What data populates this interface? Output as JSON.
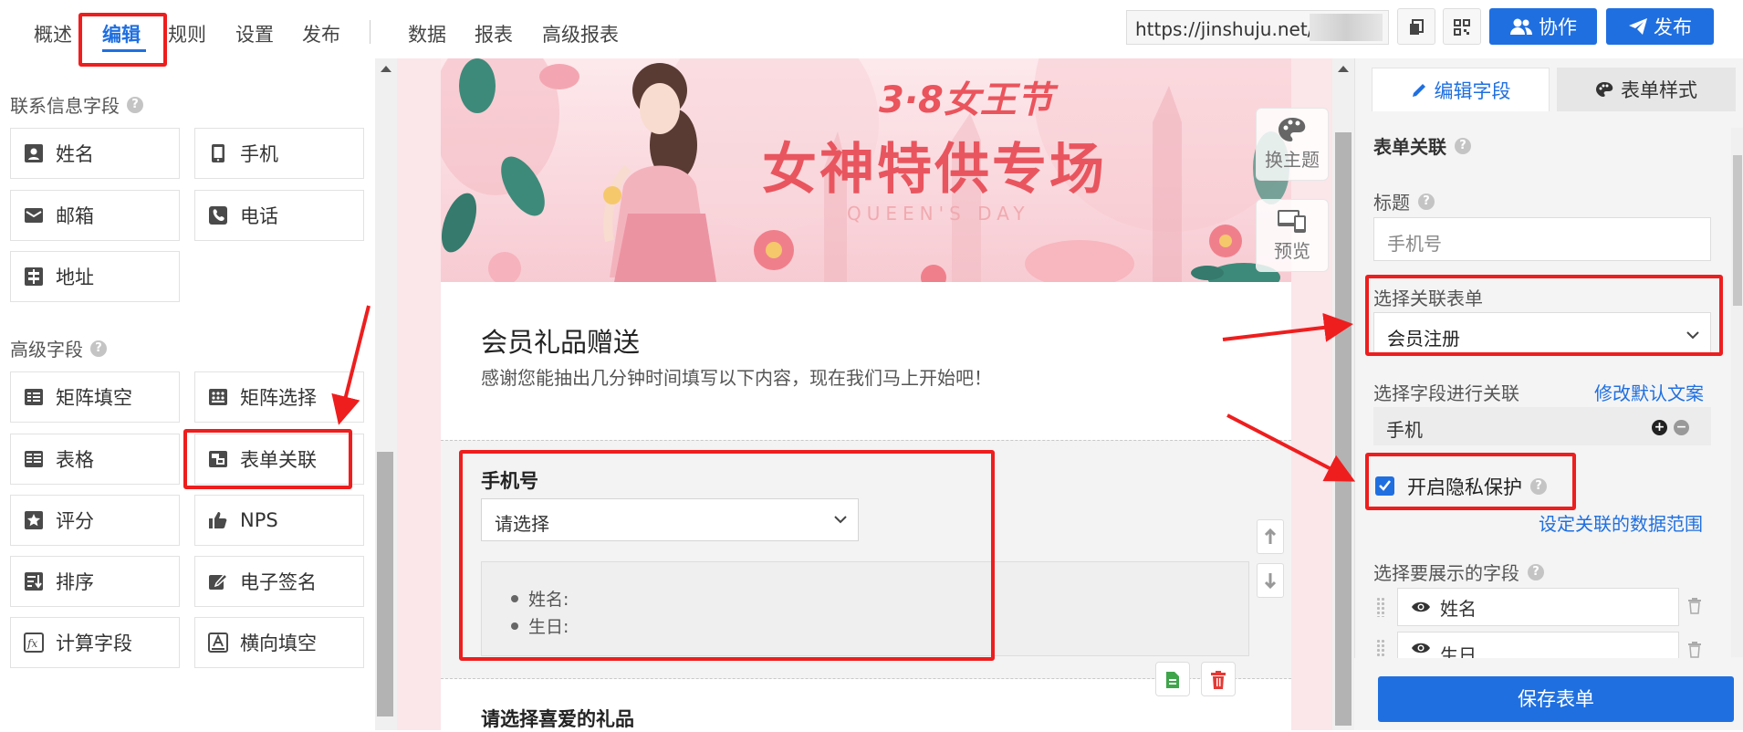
{
  "nav": {
    "tabs": [
      {
        "label": "概述"
      },
      {
        "label": "编辑"
      },
      {
        "label": "规则"
      },
      {
        "label": "设置"
      },
      {
        "label": "发布"
      },
      {
        "label": "数据"
      },
      {
        "label": "报表"
      },
      {
        "label": "高级报表"
      }
    ],
    "url": "https://jinshuju.net/f",
    "collab_label": "协作",
    "publish_label": "发布"
  },
  "left": {
    "contact_title": "联系信息字段",
    "contact_fields": [
      {
        "label": "姓名",
        "icon": "contact-card-icon"
      },
      {
        "label": "手机",
        "icon": "mobile-phone-icon"
      },
      {
        "label": "邮箱",
        "icon": "mail-icon"
      },
      {
        "label": "电话",
        "icon": "phone-icon"
      },
      {
        "label": "地址",
        "icon": "signpost-icon"
      }
    ],
    "advanced_title": "高级字段",
    "advanced_fields": [
      {
        "label": "矩阵填空",
        "icon": "matrix-fill-icon"
      },
      {
        "label": "矩阵选择",
        "icon": "matrix-select-icon"
      },
      {
        "label": "表格",
        "icon": "table-icon"
      },
      {
        "label": "表单关联",
        "icon": "form-link-icon"
      },
      {
        "label": "评分",
        "icon": "star-icon"
      },
      {
        "label": "NPS",
        "icon": "thumbs-up-icon"
      },
      {
        "label": "排序",
        "icon": "sort-icon"
      },
      {
        "label": "电子签名",
        "icon": "signature-icon"
      },
      {
        "label": "计算字段",
        "icon": "formula-icon"
      },
      {
        "label": "横向填空",
        "icon": "underline-a-icon"
      }
    ]
  },
  "banner": {
    "badge": "3·8女王节",
    "title": "女神特供专场",
    "subtitle": "QUEEN'S DAY"
  },
  "form": {
    "title": "会员礼品赠送",
    "description": "感谢您能抽出几分钟时间填写以下内容，现在我们马上开始吧！",
    "field": {
      "label": "手机号",
      "placeholder": "请选择",
      "preview_items": [
        "姓名:",
        "生日:"
      ]
    },
    "next_field_label": "请选择喜爱的礼品",
    "theme_label": "换主题",
    "preview_label": "预览"
  },
  "right": {
    "tab_edit": "编辑字段",
    "tab_style": "表单样式",
    "section_title": "表单关联",
    "title_label": "标题",
    "title_value": "手机号",
    "select_form_label": "选择关联表单",
    "select_form_value": "会员注册",
    "select_field_label": "选择字段进行关联",
    "modify_link": "修改默认文案",
    "relation_field": "手机",
    "privacy_label": "开启隐私保护",
    "privacy_checked": true,
    "range_link": "设定关联的数据范围",
    "display_label": "选择要展示的字段",
    "display_fields": [
      "姓名",
      "生日"
    ],
    "save_label": "保存表单"
  },
  "colors": {
    "accent": "#1f6fe0",
    "annotation": "#ee1e1e",
    "banner_text": "#e9555e"
  }
}
